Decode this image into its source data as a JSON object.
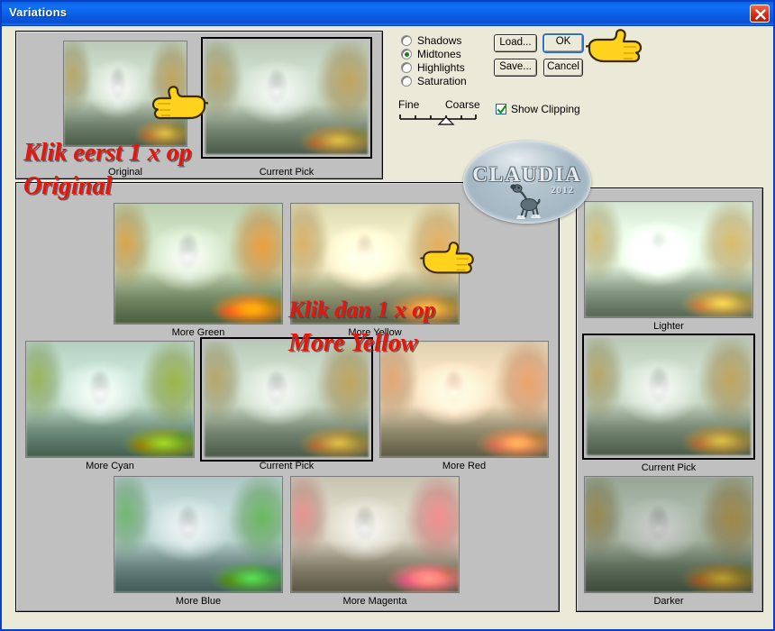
{
  "window": {
    "title": "Variations",
    "close_icon": "close-icon",
    "titlebar_color": "#0a62e8",
    "dialog_bg": "#ebe9d8",
    "panel_bg": "#c0c0c0"
  },
  "top_panel": {
    "original": {
      "label": "Original",
      "variant": "pick"
    },
    "current_pick": {
      "label": "Current Pick",
      "variant": "pick"
    }
  },
  "controls": {
    "radios": [
      {
        "label": "Shadows",
        "selected": false
      },
      {
        "label": "Midtones",
        "selected": true
      },
      {
        "label": "Highlights",
        "selected": false
      },
      {
        "label": "Saturation",
        "selected": false
      }
    ],
    "slider": {
      "min_label": "Fine",
      "max_label": "Coarse",
      "ticks": 5,
      "position": 2
    },
    "buttons": [
      {
        "label": "Load...",
        "default": false
      },
      {
        "label": "OK",
        "default": true
      },
      {
        "label": "Save...",
        "default": false
      },
      {
        "label": "Cancel",
        "default": false
      }
    ],
    "show_clipping": {
      "label": "Show Clipping",
      "checked": true,
      "icon": "checkmark-icon"
    }
  },
  "color_grid": {
    "cells": [
      {
        "label": "More Green",
        "variant": "green",
        "selected": false,
        "row": 0,
        "col": 1
      },
      {
        "label": "More Yellow",
        "variant": "yellow",
        "selected": false,
        "row": 0,
        "col": 2
      },
      {
        "label": "More Cyan",
        "variant": "cyan",
        "selected": false,
        "row": 1,
        "col": 0
      },
      {
        "label": "Current Pick",
        "variant": "pick",
        "selected": true,
        "row": 1,
        "col": 1
      },
      {
        "label": "More Red",
        "variant": "red",
        "selected": false,
        "row": 1,
        "col": 2
      },
      {
        "label": "More Blue",
        "variant": "blue",
        "selected": false,
        "row": 2,
        "col": 1
      },
      {
        "label": "More Magenta",
        "variant": "magenta",
        "selected": false,
        "row": 2,
        "col": 2
      }
    ]
  },
  "brightness_column": {
    "cells": [
      {
        "label": "Lighter",
        "variant": "lighter",
        "selected": false
      },
      {
        "label": "Current Pick",
        "variant": "pick",
        "selected": true
      },
      {
        "label": "Darker",
        "variant": "darker",
        "selected": false
      }
    ]
  },
  "annotations": {
    "color": "#e8150f",
    "line1": "Klik eerst 1 x op",
    "line2": "Original",
    "line3": "Klik dan 1 x op",
    "line4": "More Yellow"
  },
  "watermark": {
    "name": "CLAUDIA",
    "year": "2012",
    "mascot_icon": "dog-mascot-icon"
  },
  "cursors": [
    {
      "name": "pointing-hand-original"
    },
    {
      "name": "pointing-hand-ok"
    },
    {
      "name": "pointing-hand-more-yellow"
    }
  ]
}
